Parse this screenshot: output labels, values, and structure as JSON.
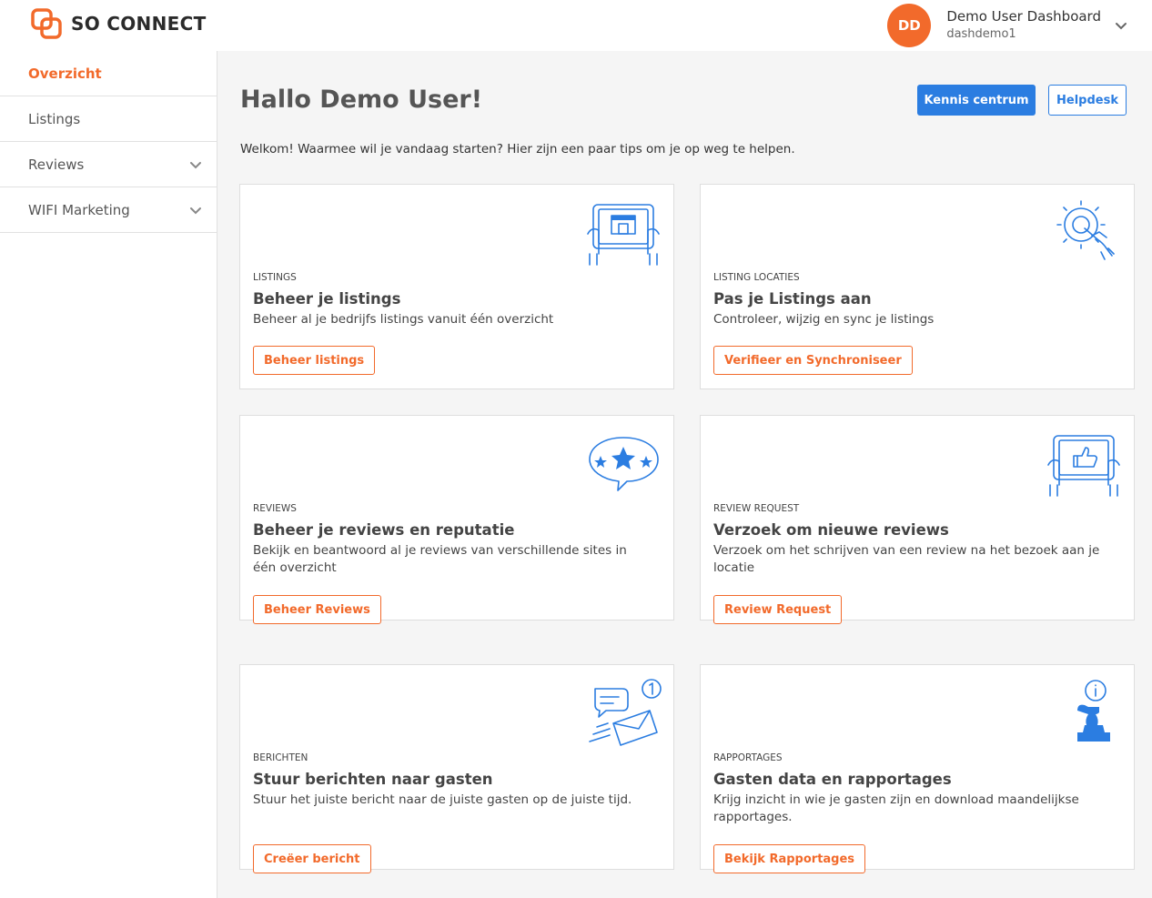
{
  "brand": {
    "name": "SO CONNECT",
    "accent": "#f26a2b",
    "primary": "#2b7de1"
  },
  "user": {
    "initials": "DD",
    "name": "Demo User Dashboard",
    "login": "dashdemo1"
  },
  "sidebar": {
    "items": [
      {
        "label": "Overzicht",
        "active": true
      },
      {
        "label": "Listings"
      },
      {
        "label": "Reviews",
        "expandable": true
      },
      {
        "label": "WIFI Marketing",
        "expandable": true
      }
    ]
  },
  "main": {
    "title": "Hallo Demo User!",
    "buttons": {
      "kennis": "Kennis centrum",
      "helpdesk": "Helpdesk"
    },
    "welcome": "Welkom! Waarmee wil je vandaag starten? Hier zijn een paar tips om je op weg te helpen.",
    "cards": [
      {
        "icon": "tablet-store-icon",
        "category": "LISTINGS",
        "title": "Beheer je listings",
        "description": "Beheer al je bedrijfs listings vanuit één overzicht",
        "button": "Beheer listings"
      },
      {
        "icon": "gear-hand-icon",
        "category": "LISTING LOCATIES",
        "title": "Pas je Listings aan",
        "description": "Controleer, wijzig en sync je listings",
        "button": "Verifieer en Synchroniseer"
      },
      {
        "icon": "star-bubble-icon",
        "category": "REVIEWS",
        "title": "Beheer je reviews en reputatie",
        "description": "Bekijk en beantwoord al je reviews van verschillende sites in één overzicht",
        "button": "Beheer Reviews"
      },
      {
        "icon": "tablet-thumbsup-icon",
        "category": "REVIEW REQUEST",
        "title": "Verzoek om nieuwe reviews",
        "description": "Verzoek om het schrijven van een review na het bezoek aan je locatie",
        "button": "Review Request"
      },
      {
        "icon": "message-envelope-icon",
        "category": "BERICHTEN",
        "title": "Stuur berichten naar gasten",
        "description": "Stuur het juiste bericht naar de juiste gasten op de juiste tijd.",
        "button": "Creëer bericht"
      },
      {
        "icon": "info-chess-icon",
        "category": "RAPPORTAGES",
        "title": "Gasten data en rapportages",
        "description": "Krijg inzicht in wie je gasten zijn en download maandelijkse rapportages.",
        "button": "Bekijk Rapportages"
      }
    ]
  }
}
